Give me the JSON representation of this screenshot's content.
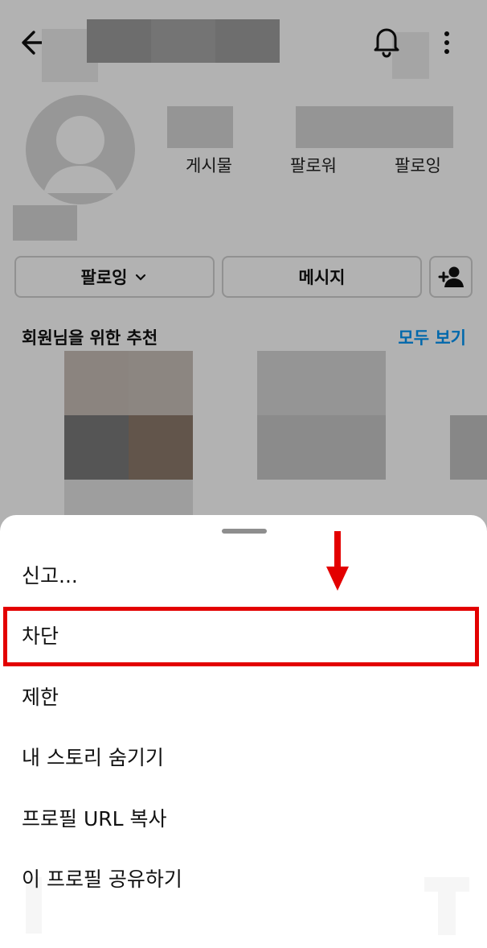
{
  "header": {
    "back_icon": "arrow-left-icon",
    "notification_icon": "bell-icon",
    "more_icon": "more-vertical-icon"
  },
  "profile": {
    "stats": [
      {
        "label": "게시물"
      },
      {
        "label": "팔로워"
      },
      {
        "label": "팔로잉"
      }
    ]
  },
  "actions": {
    "following_label": "팔로잉",
    "following_icon": "chevron-down-icon",
    "message_label": "메시지",
    "add_person_icon": "add-person-icon"
  },
  "suggestions": {
    "title": "회원님을 위한 추천",
    "see_all": "모두 보기",
    "see_all_color": "#0095f6"
  },
  "sheet": {
    "items": [
      {
        "label": "신고..."
      },
      {
        "label": "차단"
      },
      {
        "label": "제한"
      },
      {
        "label": "내 스토리 숨기기"
      },
      {
        "label": "프로필 URL 복사"
      },
      {
        "label": "이 프로필 공유하기"
      }
    ],
    "highlight_color": "#e30000"
  }
}
